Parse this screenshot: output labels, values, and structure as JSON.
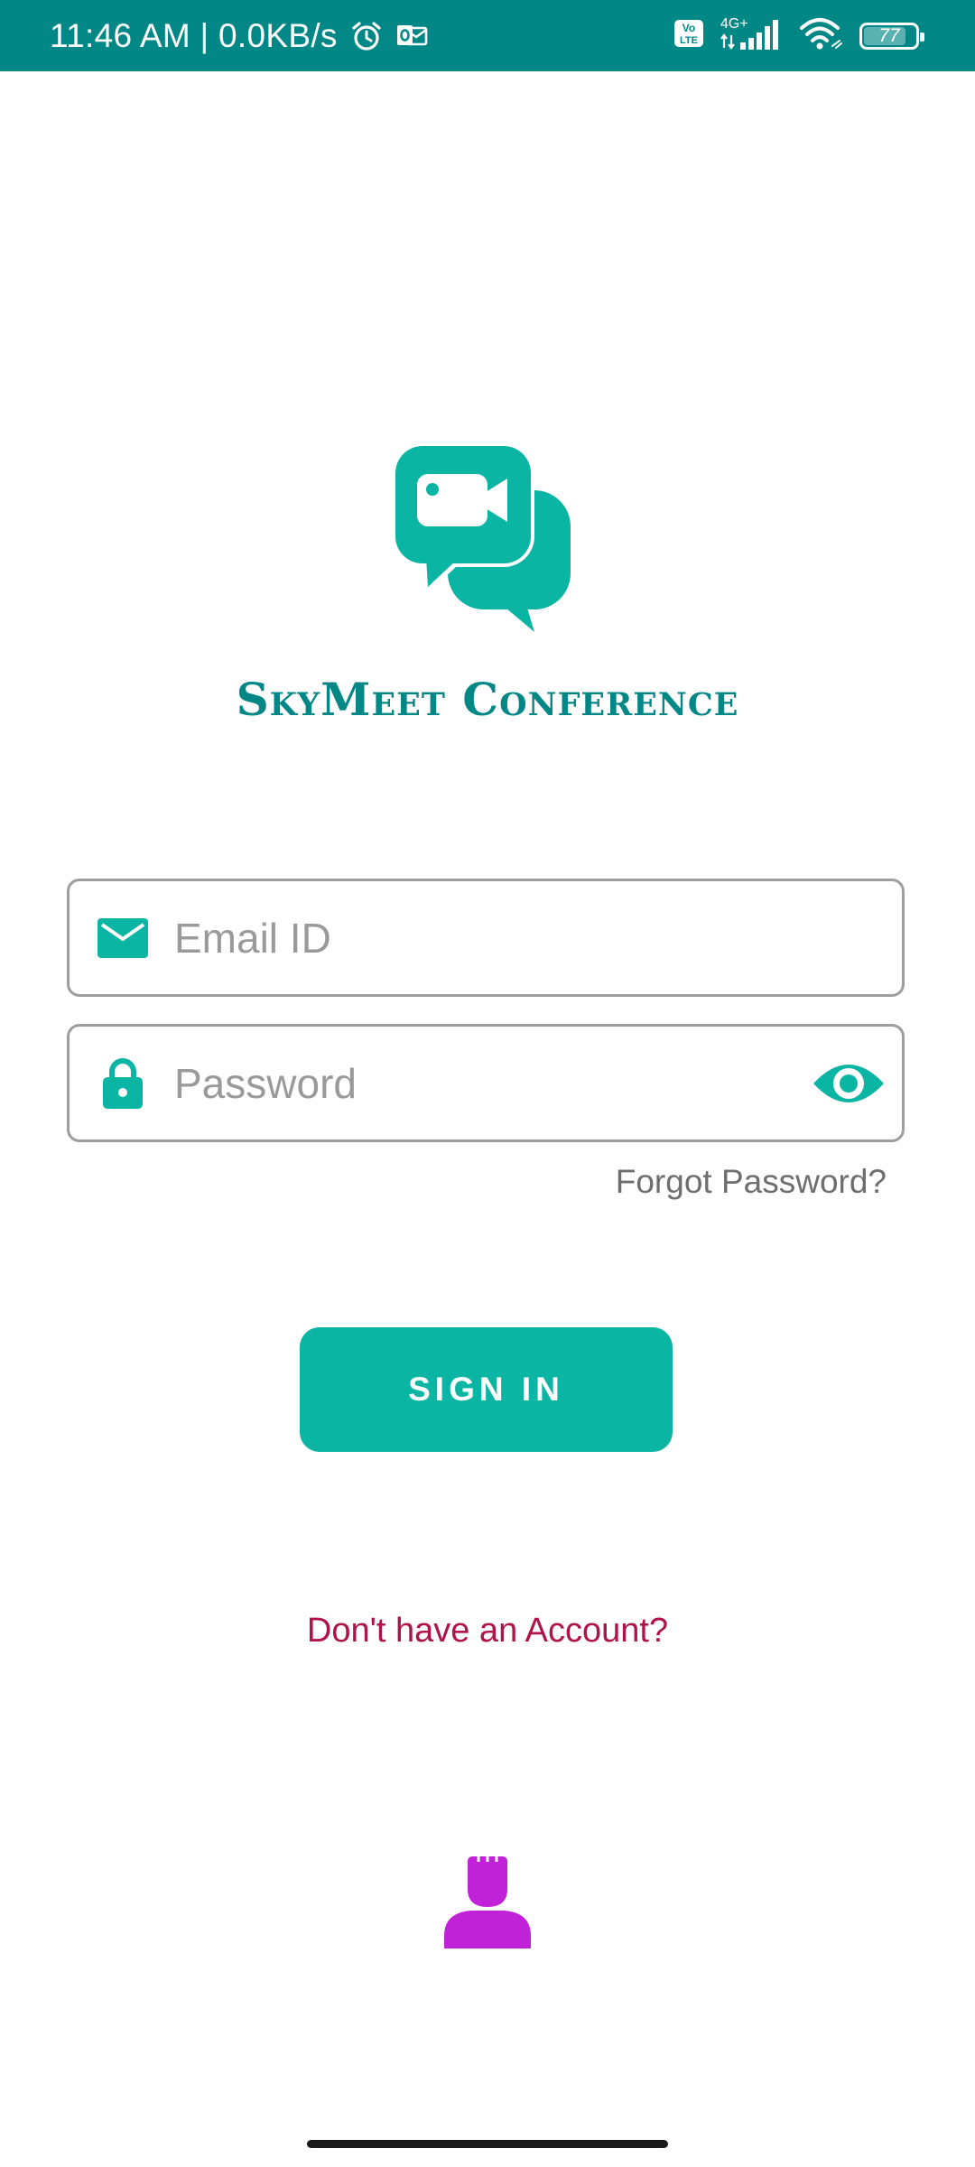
{
  "status_bar": {
    "time_speed": "11:46 AM | 0.0KB/s",
    "network": "4G+",
    "volte": "Vo LTE",
    "battery": "77",
    "battery_level": 0.77,
    "background_color": "#018786",
    "icons": [
      "alarm-icon",
      "outlook-icon",
      "volte-icon",
      "signal-icon",
      "wifi-icon",
      "battery-icon"
    ]
  },
  "app": {
    "name": "SkyMeet Conference",
    "logo_icon": "video-chat-bubbles-icon",
    "accent_color": "#0bb5a3",
    "title_color": "#018786"
  },
  "login_form": {
    "email": {
      "placeholder": "Email ID",
      "value": "",
      "icon": "mail-icon"
    },
    "password": {
      "placeholder": "Password",
      "value": "",
      "icon": "lock-icon",
      "toggle_icon": "eye-icon"
    },
    "forgot_password": "Forgot Password?",
    "sign_in": "SIGN IN"
  },
  "signup": {
    "link": "Don't have an Account?",
    "color": "#b0124a"
  },
  "footer": {
    "icon": "person-icon",
    "icon_color": "#c022d8"
  }
}
